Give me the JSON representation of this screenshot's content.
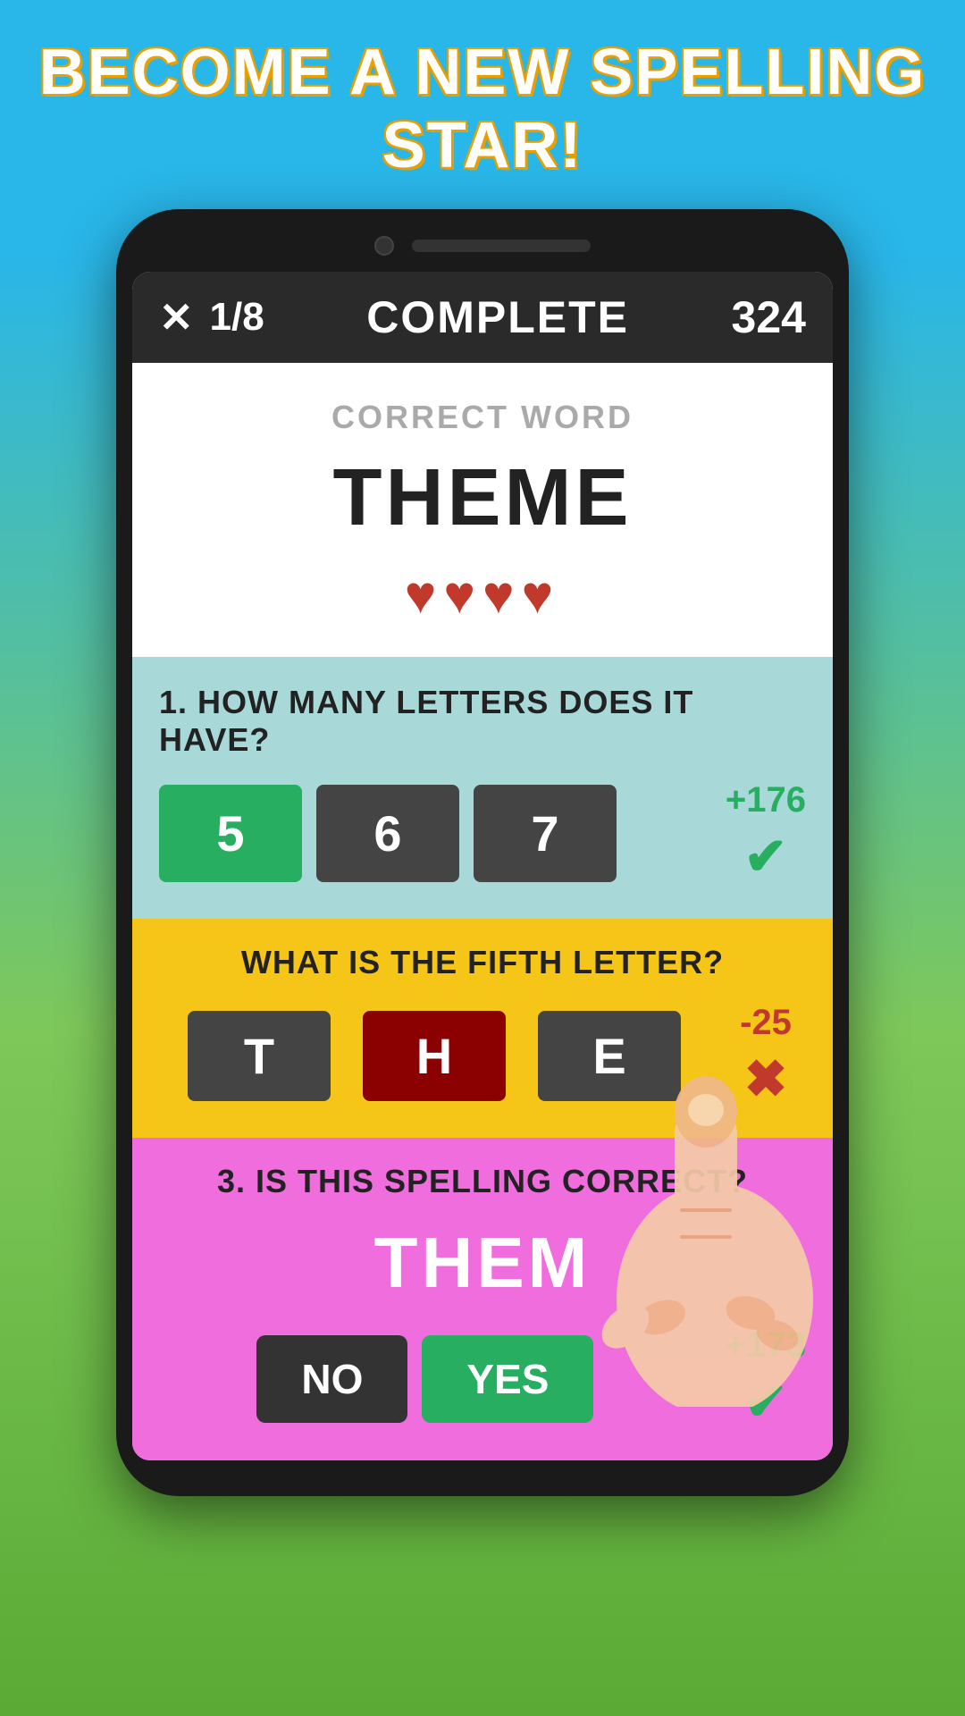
{
  "banner": {
    "title": "BECOME A NEW SPELLING STAR!"
  },
  "header": {
    "close_label": "✕",
    "progress": "1/8",
    "status": "COMPLETE",
    "score": "324"
  },
  "correct_word_section": {
    "label": "CORRECT WORD",
    "word": "THEME",
    "hearts": "♥♥♥♥"
  },
  "q1": {
    "question": "1. HOW MANY LETTERS DOES IT HAVE?",
    "options": [
      "5",
      "6",
      "7"
    ],
    "correct_index": 0,
    "result_score": "+176",
    "result": "correct"
  },
  "q2": {
    "question": "WHAT IS THE FIFTH LETTER?",
    "options": [
      "T",
      "H",
      "E"
    ],
    "wrong_index": 1,
    "result_score": "-25",
    "result": "wrong"
  },
  "q3": {
    "question": "3. IS THIS SPELLING CORRECT?",
    "word": "THEM",
    "no_label": "NO",
    "yes_label": "YES",
    "result_score": "+173",
    "result": "correct"
  }
}
